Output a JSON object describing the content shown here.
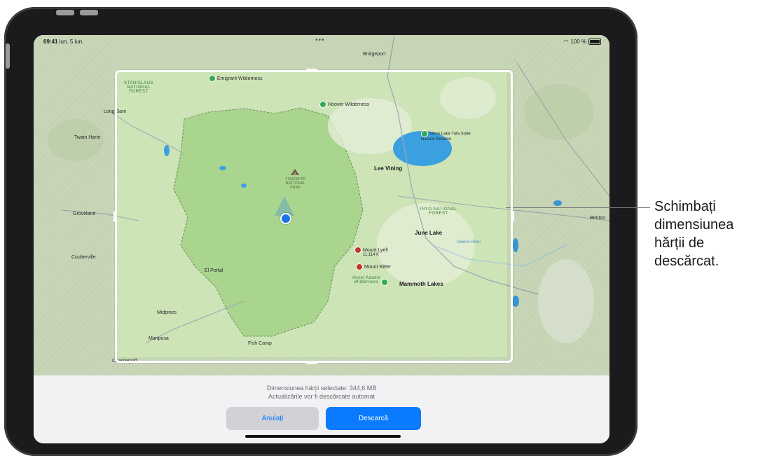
{
  "status_bar": {
    "time": "09:41",
    "date": "lun. 5 iun.",
    "battery": "100 %"
  },
  "map": {
    "top_label": "Bridgeport",
    "places": [
      {
        "name": "Emigrant Wilderness",
        "kind": "park"
      },
      {
        "name": "Hoover Wilderness",
        "kind": "park"
      },
      {
        "name": "Mono Lake Tufa State Natural Reserve",
        "kind": "park"
      },
      {
        "name": "Lee Vining",
        "kind": "town"
      },
      {
        "name": "June Lake",
        "kind": "town"
      },
      {
        "name": "Mount Lyell",
        "kind": "peak"
      },
      {
        "name": "11,114 ft",
        "kind": "elevation"
      },
      {
        "name": "Mount Ritter",
        "kind": "peak"
      },
      {
        "name": "Ansel Adams Wilderness",
        "kind": "park"
      },
      {
        "name": "Mammoth Lakes",
        "kind": "town"
      },
      {
        "name": "El Portal",
        "kind": "town"
      },
      {
        "name": "Midpines",
        "kind": "town"
      },
      {
        "name": "Mariposa",
        "kind": "town"
      },
      {
        "name": "Fish Camp",
        "kind": "town"
      },
      {
        "name": "Coarsegold",
        "kind": "town"
      },
      {
        "name": "Long Barn",
        "kind": "town"
      },
      {
        "name": "Twain Harte",
        "kind": "town"
      },
      {
        "name": "Groveland",
        "kind": "town"
      },
      {
        "name": "Coulterville",
        "kind": "town"
      },
      {
        "name": "Benton",
        "kind": "town"
      },
      {
        "name": "Owens River",
        "kind": "river"
      }
    ],
    "forest_labels": {
      "stanislaus": "STANISLAUS NATIONAL FOREST",
      "inyo": "INYO NATIONAL FOREST",
      "yosemite": "YOSEMITE NATIONAL PARK"
    }
  },
  "panel": {
    "size_text": "Dimensiunea hărții selectate: 344,6 MB",
    "update_text": "Actualizările vor fi descărcate automat",
    "cancel_label": "Anulați",
    "download_label": "Descarcă"
  },
  "callout": {
    "text": "Schimbați dimensiunea hărții de descărcat."
  },
  "colors": {
    "accent": "#0a7aff",
    "map_land": "#d9e8c9",
    "map_selected": "#c8e0b0",
    "park": "#9fcf8a",
    "water": "#3aa0e0"
  }
}
